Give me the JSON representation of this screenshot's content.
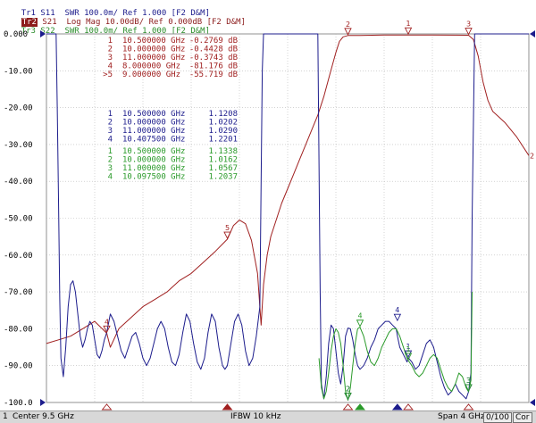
{
  "window": {
    "headers": [
      {
        "badge": "Tr1",
        "text": " S11  SWR 100.0m/ Ref 1.000 [F2 D&M]",
        "color": "#1c1c8c"
      },
      {
        "badge": "Tr2",
        "text": " S21  Log Mag 10.00dB/ Ref 0.000dB [F2 D&M]",
        "color": "#8c1c1c"
      },
      {
        "badge": "Tr3",
        "text": " S22  SWR 100.0m/ Ref 1.000 [F2 D&M]",
        "color": "#2a8c2a"
      }
    ]
  },
  "status": {
    "channel": "1",
    "center": "Center 9.5 GHz",
    "ifbw": "IFBW 10 kHz",
    "span": "Span 4 GHz",
    "sweep": "0/100",
    "cor": "Cor"
  },
  "chart_data": {
    "type": "line",
    "title": "",
    "xlabel": "",
    "ylabel": "",
    "x_range_ghz": [
      7.5,
      11.5
    ],
    "ylim": [
      -100,
      0
    ],
    "grid": true,
    "y_ticks": [
      "0.000",
      "-10.00",
      "-20.00",
      "-30.00",
      "-40.00",
      "-50.00",
      "-60.00",
      "-70.00",
      "-80.00",
      "-90.00",
      "-100.0"
    ],
    "colors": {
      "s11": "#1c1c8c",
      "s21": "#a02020",
      "s22": "#2a9a2a",
      "grid": "#b8b8b8"
    },
    "marker_table_s21": [
      {
        "num": "1",
        "freq": "10.500000 GHz",
        "value": "-0.2769 dB"
      },
      {
        "num": "2",
        "freq": "10.000000 GHz",
        "value": "-0.4428 dB"
      },
      {
        "num": "3",
        "freq": "11.000000 GHz",
        "value": "-0.3743 dB"
      },
      {
        "num": "4",
        "freq": "8.000000 GHz",
        "value": "-81.176 dB"
      },
      {
        "num": ">5",
        "freq": "9.000000 GHz",
        "value": "-55.719 dB"
      }
    ],
    "marker_table_s11": [
      {
        "num": "1",
        "freq": "10.500000 GHz",
        "value": "1.1208"
      },
      {
        "num": "2",
        "freq": "10.000000 GHz",
        "value": "1.0202"
      },
      {
        "num": "3",
        "freq": "11.000000 GHz",
        "value": "1.0290"
      },
      {
        "num": "4",
        "freq": "10.407500 GHz",
        "value": "1.2201"
      }
    ],
    "marker_table_s22": [
      {
        "num": "1",
        "freq": "10.500000 GHz",
        "value": "1.1338"
      },
      {
        "num": "2",
        "freq": "10.000000 GHz",
        "value": "1.0162"
      },
      {
        "num": "3",
        "freq": "11.000000 GHz",
        "value": "1.0567"
      },
      {
        "num": "4",
        "freq": "10.097500 GHz",
        "value": "1.2037"
      }
    ],
    "series": [
      {
        "name": "S21",
        "x": [
          7.5,
          7.6,
          7.7,
          7.8,
          7.9,
          8.0,
          8.03,
          8.1,
          8.2,
          8.3,
          8.4,
          8.5,
          8.6,
          8.7,
          8.8,
          8.9,
          9.0,
          9.05,
          9.1,
          9.15,
          9.2,
          9.25,
          9.28,
          9.3,
          9.33,
          9.36,
          9.4,
          9.45,
          9.5,
          9.55,
          9.6,
          9.65,
          9.7,
          9.75,
          9.8,
          9.85,
          9.9,
          9.93,
          9.96,
          10.0,
          10.1,
          10.3,
          10.5,
          10.7,
          10.9,
          11.0,
          11.04,
          11.08,
          11.12,
          11.16,
          11.2,
          11.3,
          11.4,
          11.5
        ],
        "y": [
          -84,
          -83,
          -82,
          -80,
          -78,
          -81.2,
          -85,
          -80,
          -77,
          -74,
          -72,
          -70,
          -67,
          -65,
          -62,
          -59,
          -55.7,
          -52,
          -50.5,
          -51.5,
          -56,
          -65,
          -79,
          -68,
          -60,
          -55,
          -51,
          -46,
          -42,
          -38,
          -34,
          -30,
          -26,
          -22,
          -17,
          -11,
          -5,
          -2,
          -0.8,
          -0.44,
          -0.4,
          -0.3,
          -0.28,
          -0.3,
          -0.35,
          -0.37,
          -1.5,
          -6,
          -13,
          -18,
          -21,
          -24,
          -28,
          -33
        ]
      },
      {
        "name": "S11",
        "x": [
          7.5,
          7.58,
          7.59,
          7.6,
          7.61,
          7.62,
          7.64,
          7.66,
          7.68,
          7.7,
          7.72,
          7.74,
          7.76,
          7.78,
          7.8,
          7.82,
          7.84,
          7.86,
          7.88,
          7.9,
          7.92,
          7.94,
          7.96,
          7.98,
          7.99,
          8.0,
          8.03,
          8.06,
          8.09,
          8.12,
          8.15,
          8.18,
          8.21,
          8.24,
          8.27,
          8.3,
          8.33,
          8.36,
          8.39,
          8.42,
          8.45,
          8.48,
          8.51,
          8.54,
          8.57,
          8.6,
          8.63,
          8.66,
          8.69,
          8.72,
          8.75,
          8.78,
          8.81,
          8.84,
          8.87,
          8.9,
          8.93,
          8.96,
          8.98,
          9.0,
          9.03,
          9.06,
          9.09,
          9.12,
          9.15,
          9.18,
          9.21,
          9.24,
          9.27,
          9.28,
          9.29,
          9.3,
          9.5,
          9.6,
          9.75,
          9.76,
          9.77,
          9.78,
          9.8,
          9.82,
          9.84,
          9.86,
          9.88,
          9.9,
          9.92,
          9.94,
          9.96,
          9.98,
          10.0,
          10.02,
          10.04,
          10.06,
          10.08,
          10.1,
          10.13,
          10.16,
          10.19,
          10.22,
          10.25,
          10.28,
          10.31,
          10.34,
          10.37,
          10.4,
          10.41,
          10.43,
          10.46,
          10.49,
          10.5,
          10.53,
          10.56,
          10.59,
          10.62,
          10.65,
          10.68,
          10.71,
          10.74,
          10.77,
          10.8,
          10.83,
          10.86,
          10.89,
          10.92,
          10.95,
          10.98,
          11.0,
          11.02,
          11.03,
          11.05,
          11.5
        ],
        "y": [
          0,
          0,
          -20,
          -45,
          -72,
          -88,
          -93,
          -85,
          -74,
          -68,
          -67,
          -70,
          -76,
          -82,
          -85,
          -83,
          -80,
          -78,
          -79,
          -83,
          -87,
          -88,
          -86,
          -83,
          -82,
          -81,
          -76,
          -78,
          -82,
          -86,
          -88,
          -85,
          -82,
          -81,
          -84,
          -88,
          -90,
          -88,
          -84,
          -80,
          -78,
          -80,
          -85,
          -89,
          -90,
          -87,
          -81,
          -76,
          -78,
          -84,
          -89,
          -91,
          -88,
          -81,
          -76,
          -78,
          -85,
          -90,
          -91,
          -90,
          -84,
          -78,
          -76,
          -79,
          -86,
          -90,
          -88,
          -82,
          -74,
          -40,
          -10,
          0,
          0,
          0,
          0,
          -35,
          -70,
          -95,
          -99,
          -93,
          -84,
          -79,
          -80,
          -86,
          -92,
          -95,
          -90,
          -82,
          -79.8,
          -80,
          -83,
          -87,
          -90,
          -91,
          -90,
          -88,
          -85,
          -83,
          -80,
          -79,
          -78,
          -78,
          -79,
          -80,
          -82,
          -85,
          -87,
          -89,
          -87.9,
          -89,
          -91,
          -90,
          -87,
          -84,
          -83,
          -85,
          -89,
          -93,
          -96,
          -98,
          -97,
          -95,
          -97,
          -98,
          -99,
          -97.1,
          -92,
          -50,
          0,
          0
        ]
      },
      {
        "name": "S22",
        "x": [
          9.76,
          9.78,
          9.8,
          9.82,
          9.84,
          9.86,
          9.88,
          9.9,
          9.92,
          9.94,
          9.96,
          9.98,
          10.0,
          10.02,
          10.04,
          10.06,
          10.08,
          10.1,
          10.13,
          10.16,
          10.19,
          10.22,
          10.25,
          10.28,
          10.31,
          10.34,
          10.37,
          10.4,
          10.43,
          10.46,
          10.49,
          10.5,
          10.53,
          10.56,
          10.59,
          10.62,
          10.65,
          10.68,
          10.71,
          10.74,
          10.77,
          10.8,
          10.83,
          10.86,
          10.89,
          10.92,
          10.95,
          10.98,
          11.0,
          11.02,
          11.03
        ],
        "y": [
          -88,
          -96,
          -99,
          -97,
          -92,
          -86,
          -82,
          -80,
          -81,
          -84,
          -90,
          -97,
          -99.4,
          -96,
          -90,
          -84,
          -80,
          -79.6,
          -82,
          -86,
          -89,
          -90,
          -88,
          -85,
          -83,
          -81,
          -80,
          -80,
          -82,
          -85,
          -88,
          -88.6,
          -90,
          -92,
          -93,
          -92,
          -90,
          -88,
          -87,
          -88,
          -91,
          -94,
          -96,
          -97,
          -95,
          -92,
          -93,
          -96,
          -97.1,
          -94,
          -70
        ]
      }
    ],
    "markers": [
      {
        "series": "S21",
        "label": "1",
        "x": 10.5,
        "y": -0.28
      },
      {
        "series": "S21",
        "label": "2",
        "x": 10.0,
        "y": -0.44
      },
      {
        "series": "S21",
        "label": "3",
        "x": 11.0,
        "y": -0.37
      },
      {
        "series": "S21",
        "label": "4",
        "x": 8.0,
        "y": -81.2
      },
      {
        "series": "S21",
        "label": "5",
        "x": 9.0,
        "y": -55.7
      },
      {
        "series": "S11",
        "label": "1",
        "x": 10.5,
        "y": -87.9
      },
      {
        "series": "S11",
        "label": "2",
        "x": 10.0,
        "y": -99.4
      },
      {
        "series": "S11",
        "label": "3",
        "x": 11.0,
        "y": -97.1
      },
      {
        "series": "S11",
        "label": "4",
        "x": 10.41,
        "y": -78.0
      },
      {
        "series": "S22",
        "label": "1",
        "x": 10.5,
        "y": -88.6
      },
      {
        "series": "S22",
        "label": "2",
        "x": 10.0,
        "y": -99.4
      },
      {
        "series": "S22",
        "label": "3",
        "x": 11.0,
        "y": -97.1
      },
      {
        "series": "S22",
        "label": "4",
        "x": 10.1,
        "y": -79.6
      }
    ]
  }
}
